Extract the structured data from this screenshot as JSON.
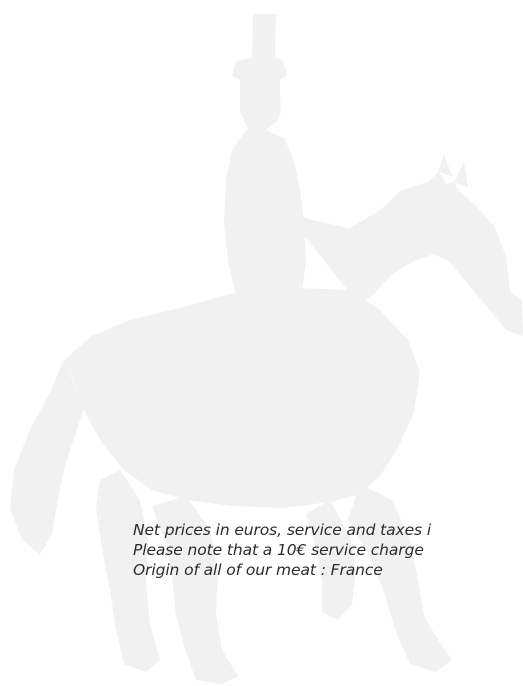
{
  "menu_footer": {
    "lines": [
      "Net prices in euros, service and taxes i",
      "Please note that a 10€ service charge",
      "Origin of all of our meat : France"
    ]
  },
  "colors": {
    "background": "#ffffff",
    "watermark": "#f1f1f1",
    "text": "#2b2b2b"
  },
  "icons": {
    "watermark": "horse-and-rider-silhouette"
  }
}
